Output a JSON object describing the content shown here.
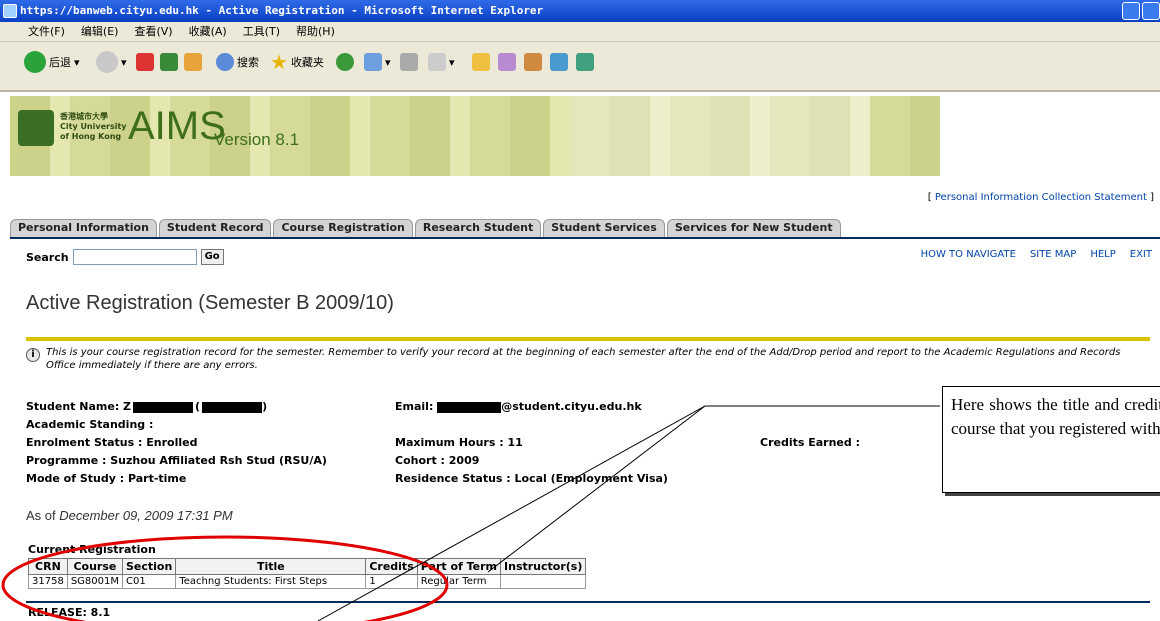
{
  "window": {
    "title": "https://banweb.cityu.edu.hk - Active Registration - Microsoft Internet Explorer"
  },
  "menu": [
    "文件(F)",
    "编辑(E)",
    "查看(V)",
    "收藏(A)",
    "工具(T)",
    "帮助(H)"
  ],
  "toolbar": {
    "back_label": "后退",
    "search_label": "搜索",
    "favorites_label": "收藏夹"
  },
  "banner": {
    "logo_lines": [
      "香港城市大學",
      "City University",
      "of Hong Kong"
    ],
    "app": "AIMS",
    "version": "Version 8.1"
  },
  "pics_link": "Personal Information Collection Statement",
  "tabs": [
    "Personal Information",
    "Student Record",
    "Course Registration",
    "Research Student",
    "Student Services",
    "Services for New Student"
  ],
  "search": {
    "label": "Search",
    "go": "Go"
  },
  "nav": [
    "HOW TO NAVIGATE",
    "SITE MAP",
    "HELP",
    "EXIT"
  ],
  "page_title": "Active Registration (Semester B 2009/10)",
  "notice": "This is your course registration record for the semester. Remember to verify your record at the beginning of each semester after the end of the Add/Drop period and report to the Academic Regulations and Records Office immediately if there are any errors.",
  "student": {
    "name_label": "Student Name: Z",
    "academic_standing": "Academic Standing :",
    "enrolment": "Enrolment Status : Enrolled",
    "programme": "Programme : Suzhou Affiliated Rsh Stud (RSU/A)",
    "mode": "Mode of Study : Part-time",
    "email_label": "Email:",
    "email_suffix": "@student.cityu.edu.hk",
    "max_hours": "Maximum Hours : 11",
    "cohort": "Cohort : 2009",
    "residence": "Residence Status : Local (Employment Visa)",
    "credits_earned": "Credits Earned :"
  },
  "as_of": {
    "prefix": "As of",
    "date": "December 09, 2009 17:31 PM"
  },
  "current_registration": {
    "heading": "Current Registration",
    "columns": [
      "CRN",
      "Course",
      "Section",
      "Title",
      "Credits",
      "Part of Term",
      "Instructor(s)"
    ],
    "rows": [
      [
        "31758",
        "SG8001M",
        "C01",
        "Teachng Students: First Steps",
        "1",
        "Regular Term",
        ""
      ]
    ]
  },
  "release": "RELEASE: 8.1",
  "callout": "Here shows the title and credit course that you registered with"
}
